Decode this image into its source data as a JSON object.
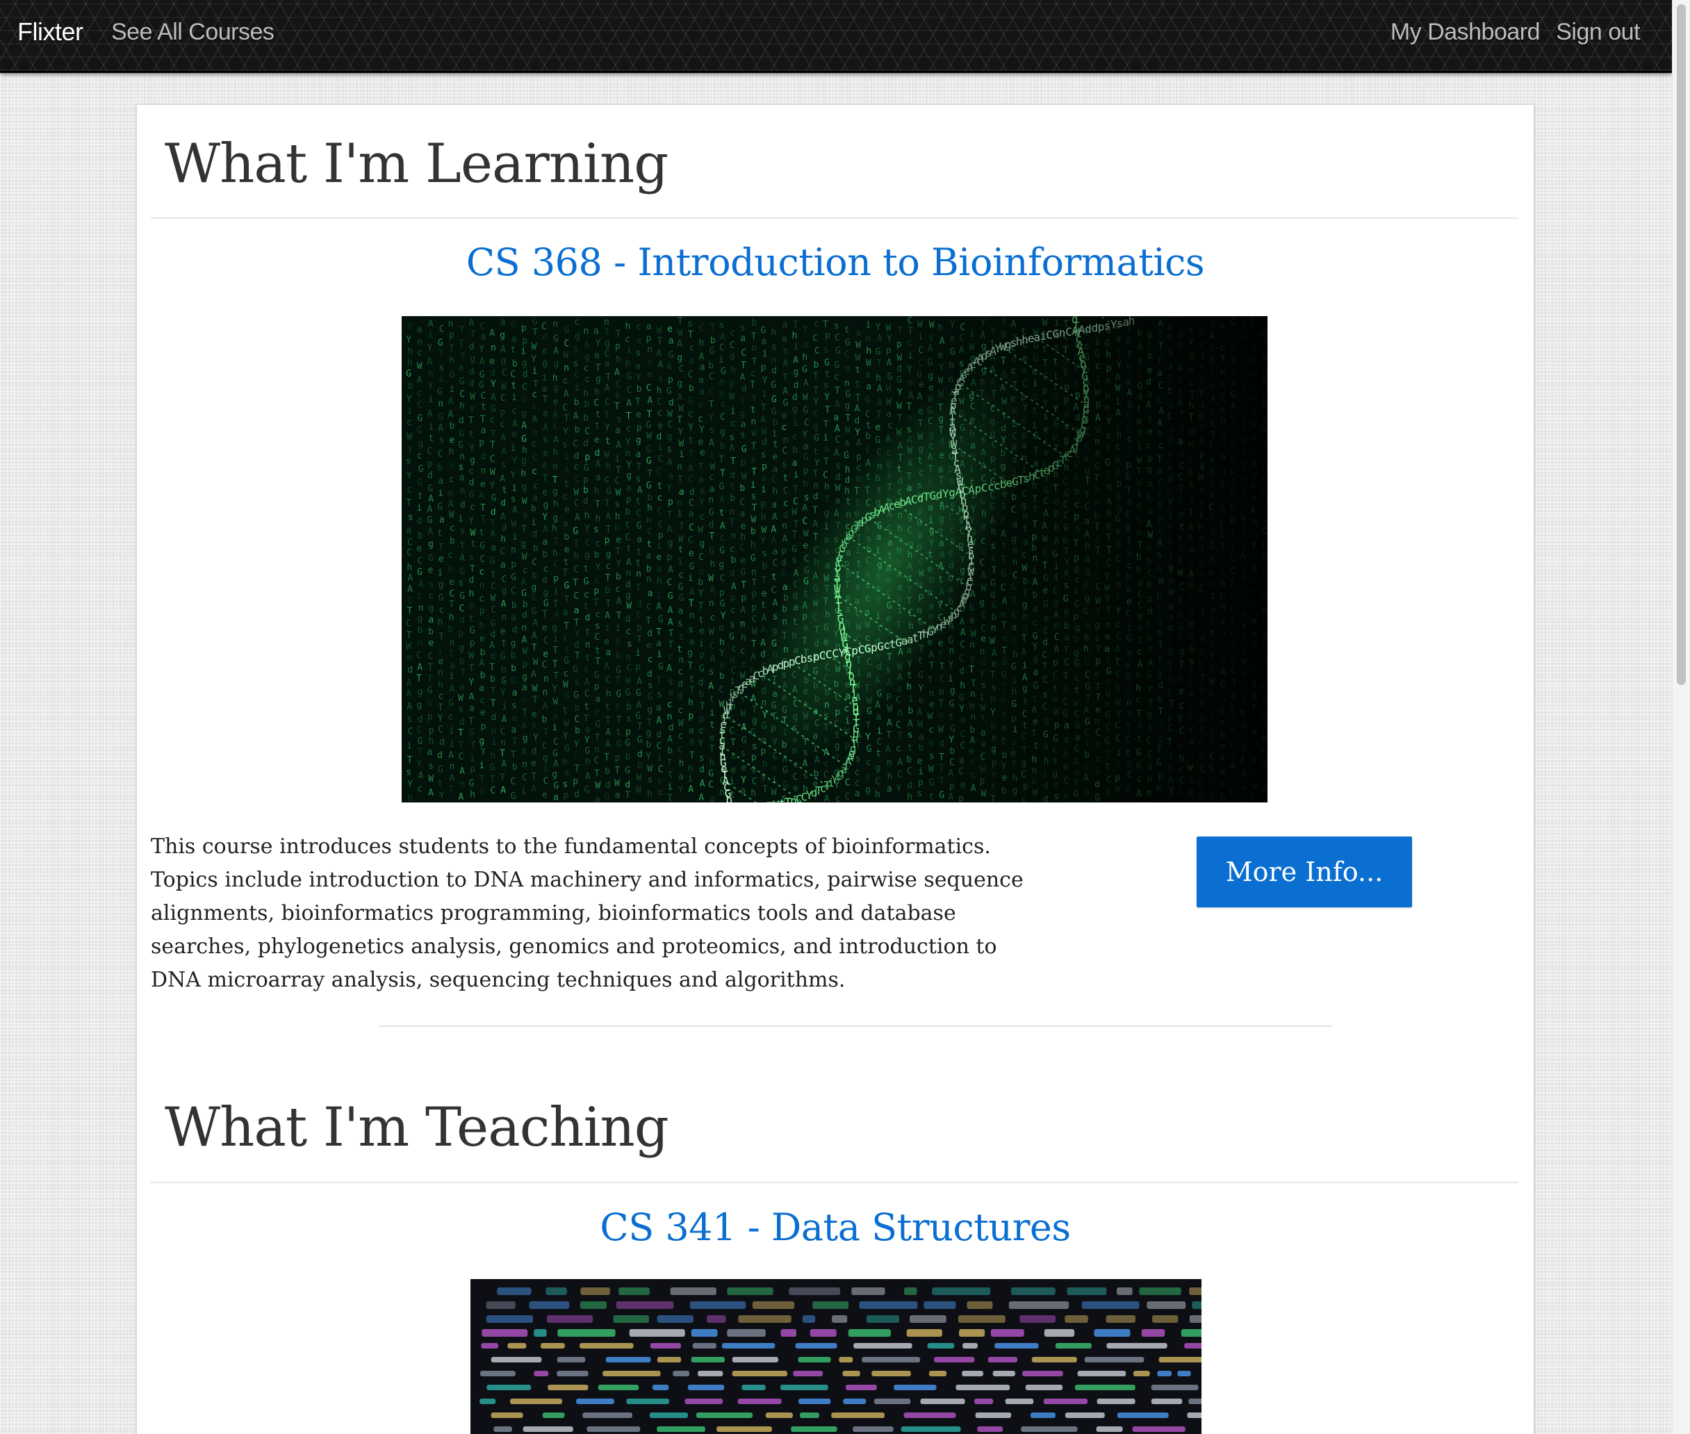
{
  "nav": {
    "brand": "Flixter",
    "see_all_courses": "See All Courses",
    "my_dashboard": "My Dashboard",
    "sign_out": "Sign out"
  },
  "learning": {
    "heading": "What I'm Learning",
    "courses": [
      {
        "title": "CS 368 - Introduction to Bioinformatics",
        "image": "dna-matrix-code-image",
        "description": "This course introduces students to the fundamental concepts of bioinformatics. Topics include introduction to DNA machinery and informatics, pairwise sequence alignments, bioinformatics programming, bioinformatics tools and database searches, phylogenetics analysis, genomics and proteomics, and introduction to DNA microarray analysis, sequencing techniques and algorithms.",
        "button_label": "More Info..."
      }
    ]
  },
  "teaching": {
    "heading": "What I'm Teaching",
    "courses": [
      {
        "title": "CS 341 - Data Structures",
        "image": "source-code-screen-image"
      }
    ]
  },
  "colors": {
    "accent": "#0a6fd1",
    "navbar": "#141414",
    "heading_text": "#333333",
    "body_text": "#222222"
  }
}
